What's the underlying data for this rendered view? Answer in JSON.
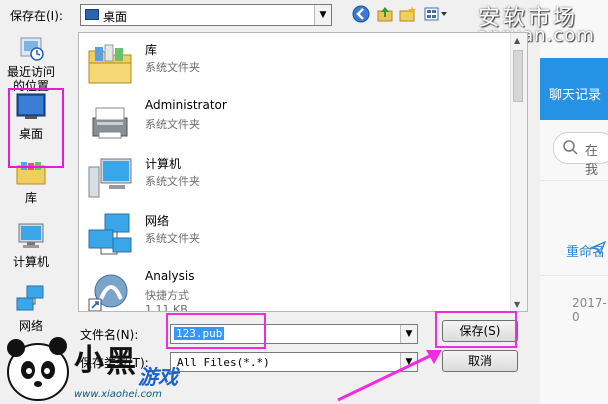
{
  "toolbar": {
    "save_in_label": "保存在(I):",
    "location": "桌面"
  },
  "watermark": {
    "title": "安软市场",
    "subtitle": "anruan.com"
  },
  "sidebar": {
    "items": [
      {
        "label": "最近访问的位置",
        "icon": "recent-places-icon"
      },
      {
        "label": "桌面",
        "icon": "desktop-icon"
      },
      {
        "label": "库",
        "icon": "libraries-icon"
      },
      {
        "label": "计算机",
        "icon": "computer-icon"
      },
      {
        "label": "网络",
        "icon": "network-icon"
      }
    ]
  },
  "files": [
    {
      "name": "库",
      "type": "系统文件夹",
      "icon": "library-folder-icon"
    },
    {
      "name": "Administrator",
      "type": "系统文件夹",
      "icon": "user-folder-icon"
    },
    {
      "name": "计算机",
      "type": "系统文件夹",
      "icon": "computer-icon"
    },
    {
      "name": "网络",
      "type": "系统文件夹",
      "icon": "network-icon"
    },
    {
      "name": "Analysis",
      "type": "快捷方式",
      "size": "1.11 KB",
      "icon": "shortcut-icon"
    }
  ],
  "form": {
    "filename_label": "文件名(N):",
    "filename_value": "123.pub",
    "filetype_label": "保存类型(T):",
    "filetype_value": "All Files(*.*)",
    "save_button": "保存(S)",
    "cancel_button": "取消"
  },
  "background_app": {
    "chat_title": "聊天记录",
    "search_text": "在 我",
    "rename_text": "重命名",
    "date_text": "2017-0"
  },
  "mascot": {
    "brand_text": "小黑游戏",
    "url": "www.xiaohei.com"
  },
  "colors": {
    "highlight": "#ef2ce0",
    "selection": "#3399ff",
    "header_blue": "#2592e6"
  }
}
